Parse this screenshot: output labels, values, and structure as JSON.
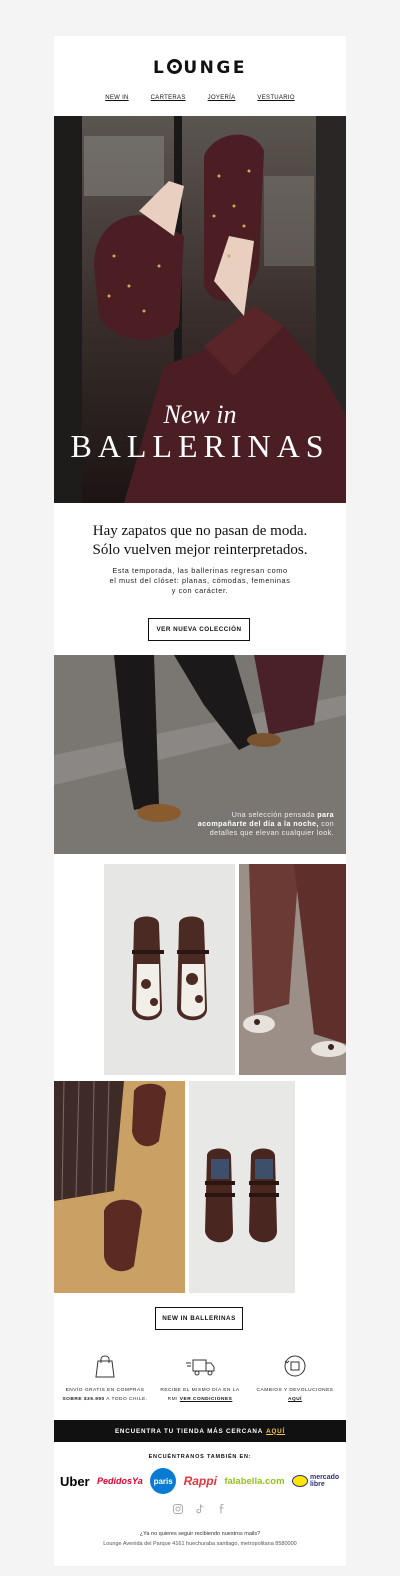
{
  "brand": {
    "logo_pre": "L",
    "logo_post": "UNGE"
  },
  "nav": {
    "items": [
      "NEW IN",
      "CARTERAS",
      "JOYERÍA",
      "VESTUARIO"
    ]
  },
  "hero": {
    "line1": "New in",
    "line2": "BALLERINAS",
    "colors": {
      "background": "#2b2222",
      "shoe": "#4a1e22"
    }
  },
  "intro": {
    "headline_line1": "Hay zapatos que no pasan de moda.",
    "headline_line2": "Sólo vuelven mejor reinterpretados.",
    "body": "Esta temporada, las ballerinas regresan como el must del clóset: planas, cómodas, femeninas y con carácter.",
    "button": "VER NUEVA COLECCIÓN"
  },
  "feature_photo": {
    "caption_part1": "Una selección pensada ",
    "caption_bold": "para acompañarte del día a la noche,",
    "caption_part2": " con detalles que elevan cualquier look."
  },
  "gallery": {
    "button": "NEW IN BALLERINAS"
  },
  "benefits": [
    {
      "icon": "shopping-bag-icon",
      "text": "ENVÍO GRATIS EN COMPRAS",
      "text2_bold": "SOBRE $39.990",
      "text2": " A TODO CHILE."
    },
    {
      "icon": "delivery-truck-icon",
      "text": "RECIBE EL MISMO DÍA EN LA",
      "text2": "RM! ",
      "link": "VER CONDICIONES"
    },
    {
      "icon": "exchange-box-icon",
      "text": "CAMBIOS Y DEVOLUCIONES",
      "link": "AQUÍ"
    }
  ],
  "store_bar": {
    "text": "ENCUENTRA TU TIENDA MÁS CERCANA",
    "link": "AQUÍ"
  },
  "partners": {
    "title": "ENCUÉNTRANOS TAMBIÉN EN:",
    "items": [
      "Uber",
      "PedidosYa",
      "paris",
      "Rappi",
      "falabella.com",
      "mercado libre"
    ],
    "colors": {
      "uber": "#000000",
      "pedidosya": "#e3002b",
      "paris": "#0a7bd3",
      "rappi": "#e5343d",
      "falabella": "#94c11e",
      "mercadolibre": "#2d3277"
    }
  },
  "socials": [
    "instagram-icon",
    "tiktok-icon",
    "facebook-icon"
  ],
  "footer": {
    "unsubscribe": "¿Ya no quieres seguir recibiendo nuestros mails?",
    "address": "Lounge Avenida del Parque 4161 huechuraba santiago, metropolitana 8580000"
  }
}
